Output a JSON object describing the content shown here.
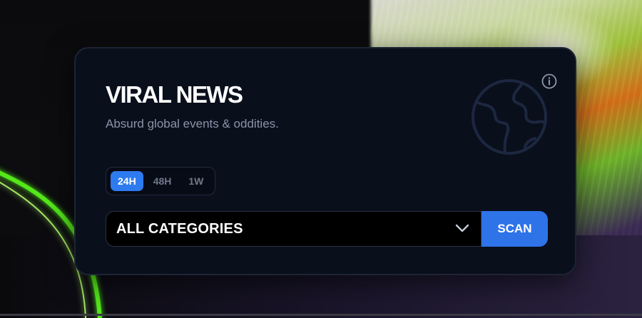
{
  "card": {
    "title": "VIRAL NEWS",
    "subtitle": "Absurd global events & oddities."
  },
  "time_range": {
    "options": [
      "24H",
      "48H",
      "1W"
    ],
    "selected": "24H"
  },
  "category_select": {
    "value": "ALL CATEGORIES"
  },
  "scan_button": {
    "label": "SCAN"
  },
  "icons": {
    "info": "info-icon",
    "globe": "globe-icon",
    "chevron": "chevron-down-icon"
  },
  "colors": {
    "accent": "#2e7bf0",
    "card_bg": "#0a0f1c",
    "neon": "#7dff3a"
  }
}
